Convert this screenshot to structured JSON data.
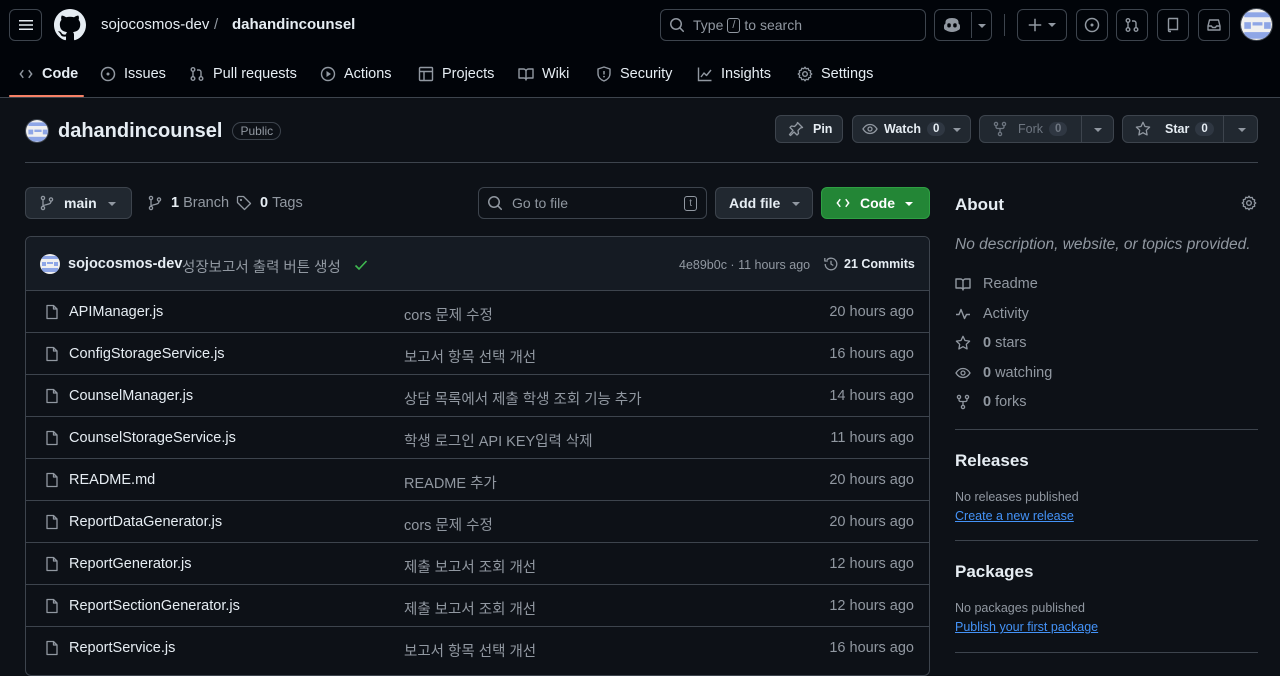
{
  "header": {
    "owner": "sojocosmos-dev",
    "separator": "/",
    "repo": "dahandincounsel",
    "search_prefix": "Type",
    "search_key": "/",
    "search_suffix": "to search"
  },
  "tabs": [
    {
      "label": "Code",
      "icon": "code-icon"
    },
    {
      "label": "Issues",
      "icon": "issue-icon"
    },
    {
      "label": "Pull requests",
      "icon": "pull-request-icon"
    },
    {
      "label": "Actions",
      "icon": "play-icon"
    },
    {
      "label": "Projects",
      "icon": "table-icon"
    },
    {
      "label": "Wiki",
      "icon": "book-icon"
    },
    {
      "label": "Security",
      "icon": "shield-icon"
    },
    {
      "label": "Insights",
      "icon": "graph-icon"
    },
    {
      "label": "Settings",
      "icon": "gear-icon"
    }
  ],
  "repo_header": {
    "name": "dahandincounsel",
    "visibility": "Public",
    "pin_label": "Pin",
    "watch_label": "Watch",
    "watch_count": "0",
    "fork_label": "Fork",
    "fork_count": "0",
    "star_label": "Star",
    "star_count": "0"
  },
  "toolbar": {
    "branch": "main",
    "branch_count": "1",
    "branch_label": "Branch",
    "tag_count": "0",
    "tag_label": "Tags",
    "goto_placeholder": "Go to file",
    "goto_key": "t",
    "add_file_label": "Add file",
    "code_label": "Code"
  },
  "commit": {
    "author": "sojocosmos-dev",
    "message": "성장보고서 출력 버튼 생성",
    "hash_time": "4e89b0c · 11 hours ago",
    "commits_label": "21 Commits"
  },
  "files": [
    {
      "name": "APIManager.js",
      "message": "cors 문제 수정",
      "time": "20 hours ago"
    },
    {
      "name": "ConfigStorageService.js",
      "message": "보고서 항목 선택 개선",
      "time": "16 hours ago"
    },
    {
      "name": "CounselManager.js",
      "message": "상담 목록에서 제출 학생 조회 기능 추가",
      "time": "14 hours ago"
    },
    {
      "name": "CounselStorageService.js",
      "message": "학생 로그인 API KEY입력 삭제",
      "time": "11 hours ago"
    },
    {
      "name": "README.md",
      "message": "README 추가",
      "time": "20 hours ago"
    },
    {
      "name": "ReportDataGenerator.js",
      "message": "cors 문제 수정",
      "time": "20 hours ago"
    },
    {
      "name": "ReportGenerator.js",
      "message": "제출 보고서 조회 개선",
      "time": "12 hours ago"
    },
    {
      "name": "ReportSectionGenerator.js",
      "message": "제출 보고서 조회 개선",
      "time": "12 hours ago"
    },
    {
      "name": "ReportService.js",
      "message": "보고서 항목 선택 개선",
      "time": "16 hours ago"
    }
  ],
  "about": {
    "title": "About",
    "description": "No description, website, or topics provided.",
    "readme": "Readme",
    "activity": "Activity",
    "stars_count": "0",
    "stars_label": "stars",
    "watching_count": "0",
    "watching_label": "watching",
    "forks_count": "0",
    "forks_label": "forks"
  },
  "releases": {
    "title": "Releases",
    "empty": "No releases published",
    "link": "Create a new release"
  },
  "packages": {
    "title": "Packages",
    "empty": "No packages published",
    "link": "Publish your first package"
  }
}
